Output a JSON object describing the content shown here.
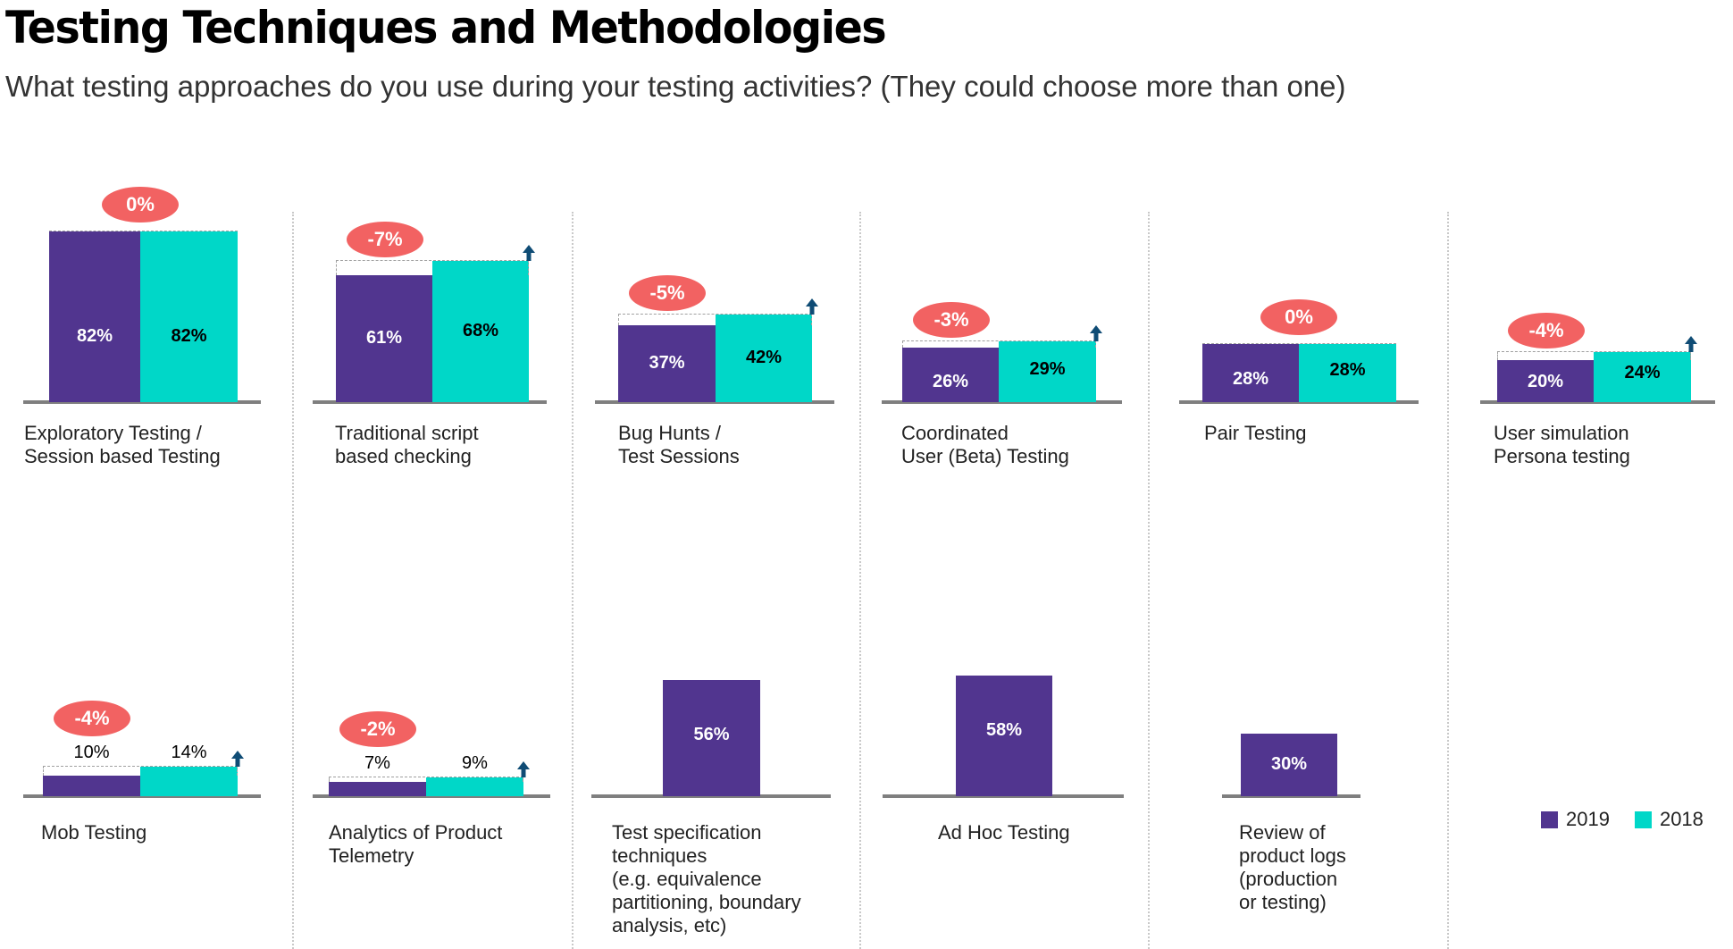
{
  "title": "Testing  Techniques  and Methodologies",
  "subtitle": "What testing approaches do you use during your testing activities? (They could choose more than one)",
  "colors": {
    "y2019": "#51358f",
    "y2018": "#00d7c8",
    "delta_badge": "#f26262",
    "arrow": "#0f4c75",
    "baseline": "#7f7f7f"
  },
  "legend": [
    {
      "label": "2019",
      "color": "#51358f"
    },
    {
      "label": "2018",
      "color": "#00d7c8"
    }
  ],
  "chart_data": {
    "type": "bar",
    "title": "Testing  Techniques  and Methodologies",
    "subtitle": "What testing approaches do you use during your testing activities? (They could choose more than one)",
    "xlabel": "",
    "ylabel": "",
    "ylim": [
      0,
      100
    ],
    "grid": false,
    "legend_position": "bottom-right",
    "series_names": [
      "2019",
      "2018"
    ],
    "categories": [
      {
        "label": "Exploratory Testing /\nSession based Testing",
        "v2019": 82,
        "v2018": 82,
        "delta": "0%",
        "v2019_label": "82%",
        "v2018_label": "82%",
        "increase_arrow": false,
        "labels_inside": true
      },
      {
        "label": "Traditional script\nbased checking",
        "v2019": 61,
        "v2018": 68,
        "delta": "-7%",
        "v2019_label": "61%",
        "v2018_label": "68%",
        "increase_arrow": true,
        "labels_inside": true
      },
      {
        "label": "Bug Hunts /\nTest Sessions",
        "v2019": 37,
        "v2018": 42,
        "delta": "-5%",
        "v2019_label": "37%",
        "v2018_label": "42%",
        "increase_arrow": true,
        "labels_inside": true
      },
      {
        "label": "Coordinated\nUser (Beta) Testing",
        "v2019": 26,
        "v2018": 29,
        "delta": "-3%",
        "v2019_label": "26%",
        "v2018_label": "29%",
        "increase_arrow": true,
        "labels_inside": true
      },
      {
        "label": "Pair Testing",
        "v2019": 28,
        "v2018": 28,
        "delta": "0%",
        "v2019_label": "28%",
        "v2018_label": "28%",
        "increase_arrow": false,
        "labels_inside": true
      },
      {
        "label": "User simulation\nPersona testing",
        "v2019": 20,
        "v2018": 24,
        "delta": "-4%",
        "v2019_label": "20%",
        "v2018_label": "24%",
        "increase_arrow": true,
        "labels_inside": true
      },
      {
        "label": "Mob Testing",
        "v2019": 10,
        "v2018": 14,
        "delta": "-4%",
        "v2019_label": "10%",
        "v2018_label": "14%",
        "increase_arrow": true,
        "labels_inside": false
      },
      {
        "label": "Analytics of Product\nTelemetry",
        "v2019": 7,
        "v2018": 9,
        "delta": "-2%",
        "v2019_label": "7%",
        "v2018_label": "9%",
        "increase_arrow": true,
        "labels_inside": false
      },
      {
        "label": "Test specification\ntechniques\n(e.g. equivalence\npartitioning, boundary\nanalysis, etc)",
        "v2019": 56,
        "v2018": null,
        "delta": null,
        "v2019_label": "56%",
        "v2018_label": null,
        "increase_arrow": false,
        "labels_inside": true
      },
      {
        "label": "Ad Hoc Testing",
        "v2019": 58,
        "v2018": null,
        "delta": null,
        "v2019_label": "58%",
        "v2018_label": null,
        "increase_arrow": false,
        "labels_inside": true
      },
      {
        "label": "Review of\nproduct logs\n(production\nor testing)",
        "v2019": 30,
        "v2018": null,
        "delta": null,
        "v2019_label": "30%",
        "v2018_label": null,
        "increase_arrow": false,
        "labels_inside": true
      }
    ]
  }
}
